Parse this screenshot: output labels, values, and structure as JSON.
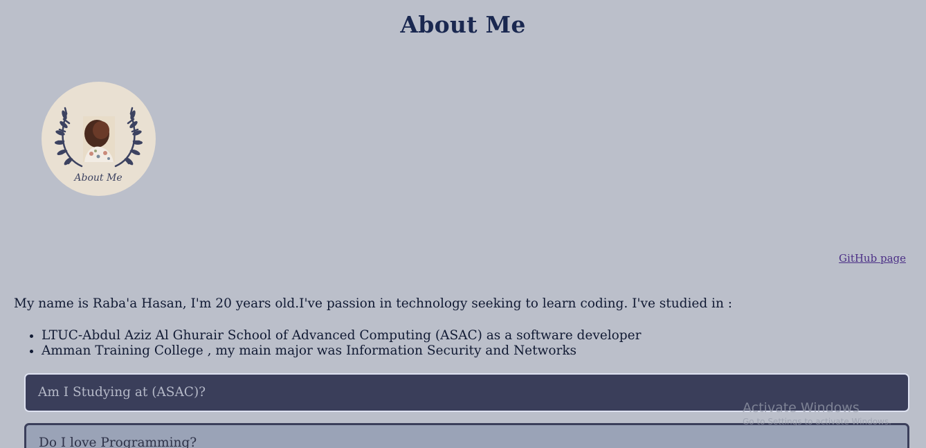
{
  "page": {
    "title": "About Me"
  },
  "avatar": {
    "caption": "About Me"
  },
  "links": {
    "github": "GitHub page"
  },
  "intro": {
    "text": "My name is Raba'a Hasan, I'm 20 years old.I've passion in technology seeking to learn coding. I've studied in :",
    "schools": [
      "LTUC-Abdul Aziz Al Ghurair School of Advanced Computing (ASAC) as a software developer",
      "Amman Training College , my main major was Information Security and Networks"
    ]
  },
  "accordion": [
    {
      "question": "Am I Studying at (ASAC)?"
    },
    {
      "question": "Do I love Programming?"
    }
  ],
  "watermark": {
    "title": "Activate Windows",
    "subtitle": "Go to Settings to activate Windows."
  },
  "colors": {
    "background": "#bbbfca",
    "heading": "#1a2850",
    "accordion_active": "#3a3e5a",
    "accordion_inactive": "#9aa3b7",
    "link": "#4b2f86"
  }
}
